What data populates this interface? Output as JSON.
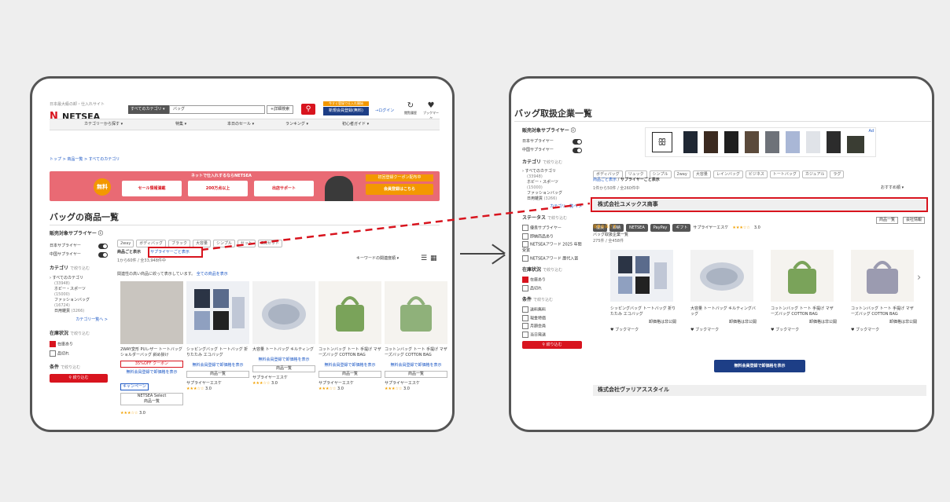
{
  "left": {
    "logo_text": "NETSEA",
    "logo_tagline": "日本最大級の卸・仕入れサイト",
    "category_select": "すべてのカテゴリ",
    "search_value": "バッグ",
    "detail_search": "+詳細検索",
    "register_banner_top": "今すぐ登録で仕入れ開始",
    "register_button": "新規会員登録(無料)",
    "login": "ログイン",
    "icon_history": "閲覧履歴",
    "icon_bookmark": "ブックマーク",
    "nav": [
      "カテゴリーから探す",
      "特集",
      "本日のセール",
      "ランキング",
      "初心者ガイド"
    ],
    "breadcrumb": "トップ > 商品一覧 > すべてのカテゴリ",
    "banner": {
      "headline": "ネットで仕入れするならNETSEA",
      "badge": "無料",
      "box1": "セール情報満載",
      "box2": "200万点以上",
      "box3": "出店サポート",
      "cta_top": "初回登録クーポン配布中",
      "cta": "会員登録はこちら"
    },
    "page_title": "バッグの商品一覧",
    "sidebar": {
      "supplier_title": "販売対象サプライヤー",
      "suppliers": [
        "日本サプライヤー",
        "中国サプライヤー"
      ],
      "category_title": "カテゴリ",
      "category_hint": "で絞り込む",
      "categories": [
        "すべてのカテゴリ",
        "(33948)",
        "ホビー・スポーツ",
        "(15000)",
        "ファッションバッグ",
        "(16724)",
        "日用雑貨",
        "(3266)"
      ],
      "more_categories": "カテゴリ一覧へ >",
      "stock_title": "在庫状況",
      "stock_hint": "で絞り込む",
      "stock_options": [
        "在庫あり",
        "品切れ"
      ],
      "cond_title": "条件",
      "cond_hint": "で絞り込む",
      "filter_button": "絞り込む"
    },
    "tags": [
      "2way",
      "ボディバッグ",
      "ブラック",
      "大容量",
      "シンプル",
      "セット",
      "3点セット"
    ],
    "view_mode_label": "商品ごと表示",
    "view_supplier_link": "サプライヤーごと表示",
    "count_text": "1から60件 / 全33,948件中",
    "sort": "キーワードの関連度順",
    "note_text": "関連性の高い商品に絞って表示しています。",
    "note_link": "全ての商品を表示",
    "products": [
      {
        "name": "2WAY変形 PUレザー トートバッグ ショルダーバッグ 斜め掛け",
        "price_note": "35%OFF クーポン",
        "btn1": "無料会員登録で卸価格を表示",
        "btn2": "キャンペーン",
        "shop": "NETSEA Select",
        "btn3": "商品一覧",
        "stars": "★★★☆☆",
        "rating": "3.0"
      },
      {
        "name": "シッピングバッグ トートバッグ 折りたたみ エコバッグ",
        "price_note": "",
        "btn1": "無料会員登録で卸価格を表示",
        "btn2": "",
        "shop": "サプライヤーエスケ",
        "btn3": "商品一覧",
        "stars": "★★★☆☆",
        "rating": "3.0"
      },
      {
        "name": "大容量 トートバッグ キルティング",
        "price_note": "",
        "btn1": "無料会員登録で卸価格を表示",
        "btn2": "",
        "shop": "サプライヤーエスケ",
        "btn3": "商品一覧",
        "stars": "★★★☆☆",
        "rating": "3.0"
      },
      {
        "name": "コットンバッグ トート 手提げ マザーズバッグ COTTON BAG",
        "price_note": "",
        "btn1": "無料会員登録で卸価格を表示",
        "btn2": "",
        "shop": "サプライヤーエスケ",
        "btn3": "商品一覧",
        "stars": "★★★☆☆",
        "rating": "3.0"
      },
      {
        "name": "コットンバッグ トート 手提げ マザーズバッグ COTTON BAG",
        "price_note": "",
        "btn1": "無料会員登録で卸価格を表示",
        "btn2": "",
        "shop": "サプライヤーエスケ",
        "btn3": "商品一覧",
        "stars": "★★★☆☆",
        "rating": "3.0"
      }
    ]
  },
  "right": {
    "page_title": "バッグ取扱企業一覧",
    "sidebar": {
      "supplier_title": "販売対象サプライヤー",
      "suppliers": [
        "日本サプライヤー",
        "中国サプライヤー"
      ],
      "category_title": "カテゴリ",
      "category_hint": "で絞り込む",
      "categories": [
        "すべてのカテゴリ",
        "(33948)",
        "ホビー・スポーツ",
        "(15000)",
        "ファッションバッグ",
        "日用雑貨",
        "(3266)"
      ],
      "more_categories": "カテゴリ一覧へ >",
      "status_title": "ステータス",
      "status_hint": "で絞り込む",
      "status_options": [
        "優良サプライヤー",
        "即納商品あり",
        "NETSEAアワード 2025 年間 受賞",
        "NETSEAアワード 歴代入賞"
      ],
      "stock_title": "在庫状況",
      "stock_hint": "で絞り込む",
      "stock_options": [
        "在庫あり",
        "品切れ"
      ],
      "cond_title": "条件",
      "cond_hint": "で絞り込む",
      "cond_options": [
        "送料無料",
        "現金特価",
        "月額会員",
        "当日発送"
      ],
      "filter_button": "絞り込む"
    },
    "ad_label": "Ad",
    "tags": [
      "ボディバッグ",
      "リュック",
      "シンプル",
      "2way",
      "大容量",
      "レインバッグ",
      "ビジネス",
      "トートバッグ",
      "カジュアル",
      "ラグ"
    ],
    "view_mode_link": "商品ごと表示",
    "view_mode_current": "サプライヤーごと表示",
    "count_text": "1件から50件 / 全260件中",
    "sort": "おすすめ順",
    "company1": {
      "name": "株式会社ユメックス商事",
      "badges": [
        "優良",
        "即納",
        "NETSEA",
        "PayPay",
        "ギフト"
      ],
      "supplier": "サプライヤーエスケ",
      "stars": "★★★☆☆",
      "rating": "3.0",
      "sub_note": "優良会員さま",
      "btn1": "商品一覧",
      "btn2": "会社情報",
      "cat_title": "バッグ取扱企業一覧",
      "cat_count": "275件 / 全458件",
      "products": [
        {
          "name": "シッピングバッグ トートバッグ 折りたたみ エコバッグ",
          "price": "卸価格は非公開"
        },
        {
          "name": "大容量 トートバッグ キルティングバッグ",
          "price": "卸価格は非公開"
        },
        {
          "name": "コットンバッグ トート 手提げ マザーズバッグ COTTON BAG",
          "price": "卸価格は非公開"
        },
        {
          "name": "コットンバッグ トート 手提げ マザーズバッグ COTTON BAG",
          "price": "卸価格は非公開"
        }
      ],
      "bookmark": "ブックマーク"
    },
    "register_button": "無料会員登録で卸価格を表示",
    "company2": {
      "name": "株式会社ヴァリアススタイル"
    }
  },
  "colors": {
    "netsea_red": "#d8141e",
    "orange": "#f39800",
    "banner_pink": "#e96a74",
    "link_blue": "#1a56c4"
  }
}
